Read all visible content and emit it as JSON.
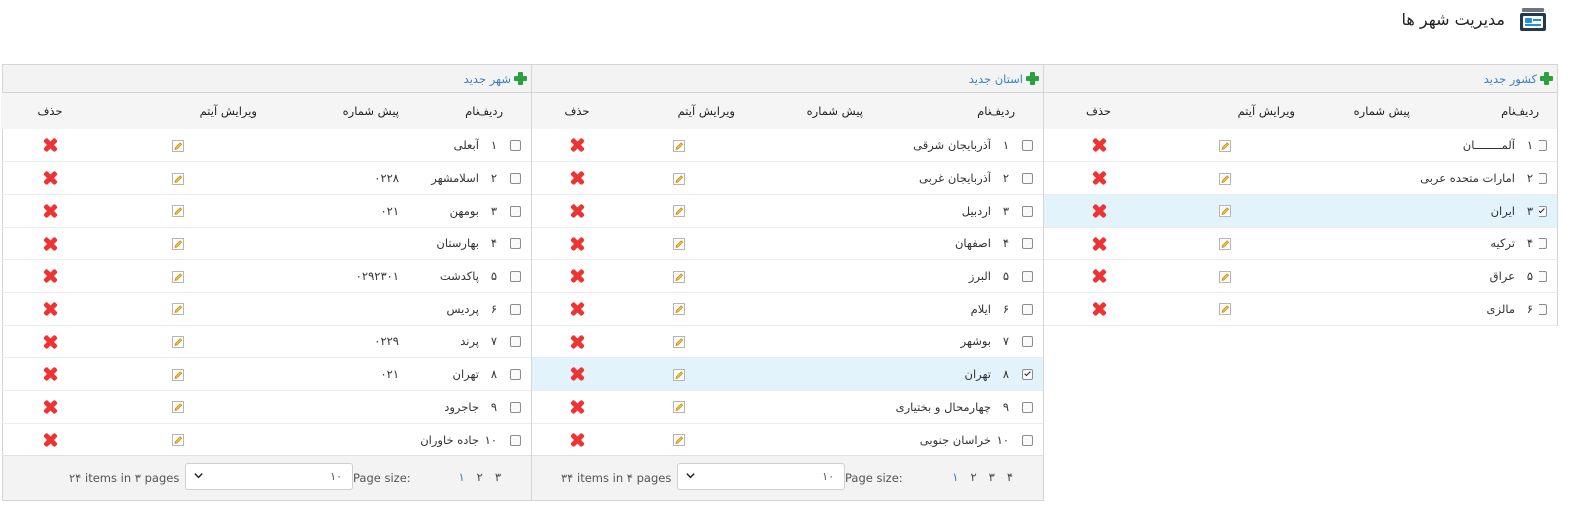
{
  "page": {
    "title": "مدیریت شهر ها",
    "icon": "card-stack-icon"
  },
  "colors": {
    "accent_link": "#3a7fc5",
    "add_green": "#2aa040",
    "delete_red": "#ec3434",
    "selected_row": "#e2f3fb"
  },
  "countries": {
    "add_label": "کشور جدید",
    "headers": {
      "index": "ردیف",
      "name": "نام",
      "prefix": "پیش شماره",
      "edit": "ویرایش آیتم",
      "delete": "حذف"
    },
    "rows": [
      {
        "idx": "۱",
        "name": "آلمــــــــان",
        "prefix": "",
        "selected": false
      },
      {
        "idx": "۲",
        "name": "امارات متحده عربی",
        "prefix": "",
        "selected": false
      },
      {
        "idx": "۳",
        "name": "ایران",
        "prefix": "",
        "selected": true
      },
      {
        "idx": "۴",
        "name": "ترکیه",
        "prefix": "",
        "selected": false
      },
      {
        "idx": "۵",
        "name": "عراق",
        "prefix": "",
        "selected": false
      },
      {
        "idx": "۶",
        "name": "مالزی",
        "prefix": "",
        "selected": false
      }
    ]
  },
  "provinces": {
    "add_label": "استان جدید",
    "headers": {
      "index": "ردیف",
      "name": "نام",
      "prefix": "پیش شماره",
      "edit": "ویرایش آیتم",
      "delete": "حذف"
    },
    "rows": [
      {
        "idx": "۱",
        "name": "آذربایجان شرقی",
        "prefix": "",
        "selected": false
      },
      {
        "idx": "۲",
        "name": "آذربایجان غربی",
        "prefix": "",
        "selected": false
      },
      {
        "idx": "۳",
        "name": "اردبیل",
        "prefix": "",
        "selected": false
      },
      {
        "idx": "۴",
        "name": "اصفهان",
        "prefix": "",
        "selected": false
      },
      {
        "idx": "۵",
        "name": "البرز",
        "prefix": "",
        "selected": false
      },
      {
        "idx": "۶",
        "name": "ایلام",
        "prefix": "",
        "selected": false
      },
      {
        "idx": "۷",
        "name": "بوشهر",
        "prefix": "",
        "selected": false
      },
      {
        "idx": "۸",
        "name": "تهران",
        "prefix": "",
        "selected": true
      },
      {
        "idx": "۹",
        "name": "چهارمحال و بختیاری",
        "prefix": "",
        "selected": false
      },
      {
        "idx": "۱۰",
        "name": "خراسان جنوبی",
        "prefix": "",
        "selected": false
      }
    ],
    "pager": {
      "pages": [
        "۱",
        "۲",
        "۳",
        "۴"
      ],
      "current": "۱",
      "page_size_label": "Page size:",
      "page_size": "۱۰",
      "summary": "۳۴ items in ۴ pages"
    }
  },
  "cities": {
    "add_label": "شهر جدید",
    "headers": {
      "index": "ردیف",
      "name": "نام",
      "prefix": "پیش شماره",
      "edit": "ویرایش آیتم",
      "delete": "حذف"
    },
    "rows": [
      {
        "idx": "۱",
        "name": "آبعلی",
        "prefix": "",
        "selected": false
      },
      {
        "idx": "۲",
        "name": "اسلامشهر",
        "prefix": "۰۲۲۸",
        "selected": false
      },
      {
        "idx": "۳",
        "name": "بومهن",
        "prefix": "۰۲۱",
        "selected": false
      },
      {
        "idx": "۴",
        "name": "بهارستان",
        "prefix": "",
        "selected": false
      },
      {
        "idx": "۵",
        "name": "پاکدشت",
        "prefix": "۰۲۹۲۳۰۱",
        "selected": false
      },
      {
        "idx": "۶",
        "name": "پردیس",
        "prefix": "",
        "selected": false
      },
      {
        "idx": "۷",
        "name": "پرند",
        "prefix": "۰۲۲۹",
        "selected": false
      },
      {
        "idx": "۸",
        "name": "تهران",
        "prefix": "۰۲۱",
        "selected": false
      },
      {
        "idx": "۹",
        "name": "جاجرود",
        "prefix": "",
        "selected": false
      },
      {
        "idx": "۱۰",
        "name": "جاده خاوران",
        "prefix": "",
        "selected": false
      }
    ],
    "pager": {
      "pages": [
        "۱",
        "۲",
        "۳"
      ],
      "current": "۱",
      "page_size_label": "Page size:",
      "page_size": "۱۰",
      "summary": "۲۴ items in ۳ pages"
    }
  }
}
